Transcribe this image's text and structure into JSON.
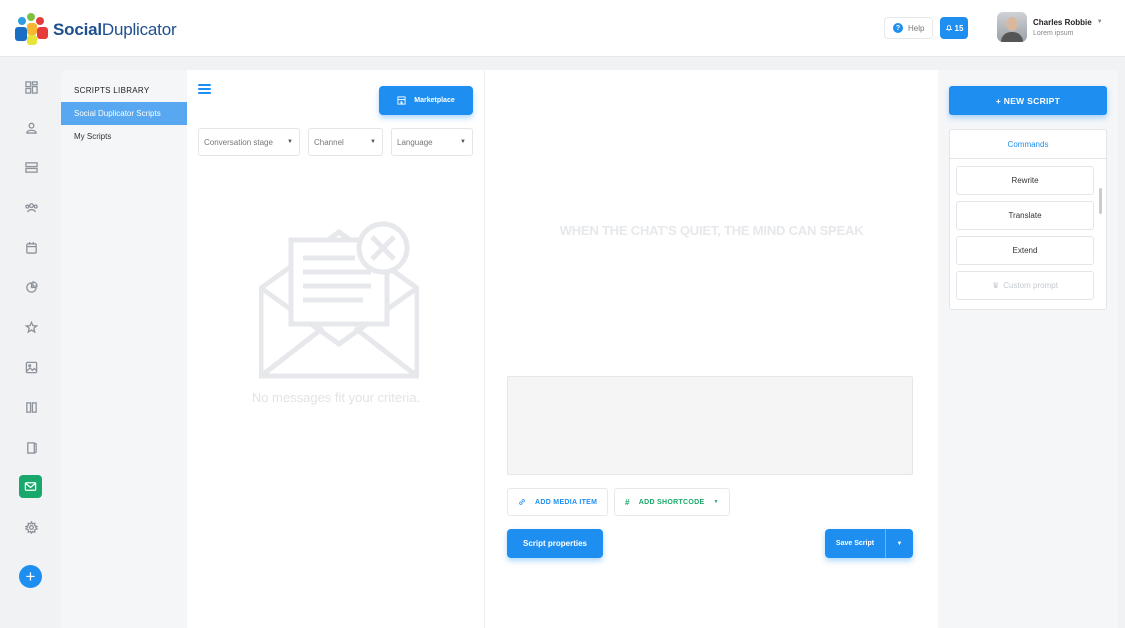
{
  "app": {
    "logo_bold": "Social",
    "logo_rest": "Duplicator"
  },
  "header": {
    "help_label": "Help",
    "notifications_count": "15",
    "user_name": "Charles Robbie",
    "user_subtitle": "Lorem ipsum"
  },
  "sidenav": {
    "icons": [
      "dashboard-icon",
      "user-icon",
      "list-icon",
      "team-icon",
      "calendar-icon",
      "analytics-icon",
      "star-icon",
      "image-icon",
      "columns-icon",
      "book-icon",
      "mail-icon",
      "settings-icon",
      "plus-icon"
    ],
    "active": "mail-icon"
  },
  "library": {
    "title": "SCRIPTS LIBRARY",
    "items": [
      {
        "label": "Social Duplicator Scripts",
        "active": true
      },
      {
        "label": "My Scripts",
        "active": false
      }
    ]
  },
  "list_panel": {
    "marketplace_label": "Marketplace",
    "filters": [
      {
        "label": "Conversation stage"
      },
      {
        "label": "Channel"
      },
      {
        "label": "Language"
      }
    ],
    "empty_text": "No messages fit your criteria."
  },
  "editor": {
    "quote": "WHEN THE CHAT'S QUIET, THE MIND CAN SPEAK",
    "add_media_label": "ADD MEDIA ITEM",
    "add_shortcode_label": "ADD SHORTCODE",
    "script_properties_label": "Script properties",
    "save_label": "Save Script"
  },
  "right_panel": {
    "new_script_label": "+ NEW SCRIPT",
    "commands_tab": "Commands",
    "commands": [
      {
        "label": "Rewrite",
        "enabled": true
      },
      {
        "label": "Translate",
        "enabled": true
      },
      {
        "label": "Extend",
        "enabled": true
      },
      {
        "label": "Custom prompt",
        "enabled": false
      }
    ]
  },
  "colors": {
    "primary": "#1e8ff0",
    "accent_green": "#19a86b"
  }
}
